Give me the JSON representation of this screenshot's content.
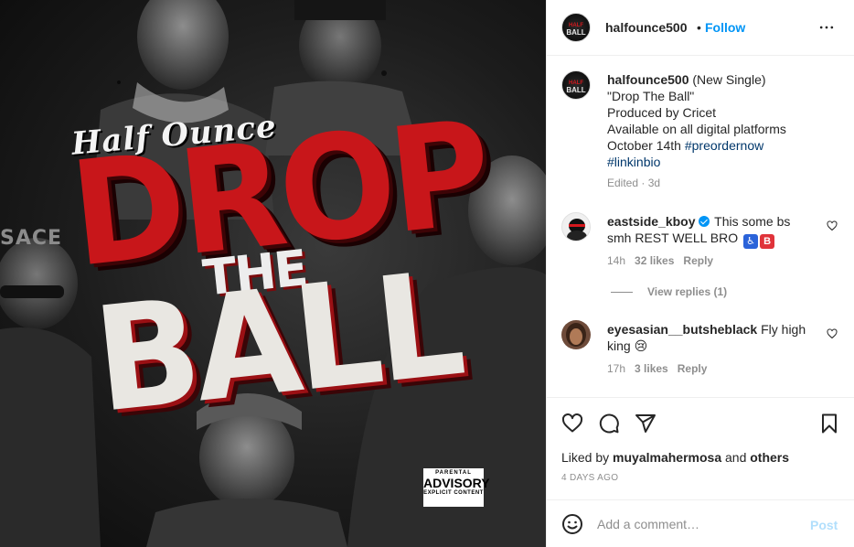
{
  "media": {
    "artist_text": "Half Ounce",
    "title_word1": "DROP",
    "title_word2": "THE",
    "title_word3": "BALL",
    "side_text_left": "SACE",
    "advisory": {
      "line1": "PARENTAL",
      "line2": "ADVISORY",
      "line3": "EXPLICIT CONTENT"
    }
  },
  "header": {
    "username": "halfounce500",
    "separator": "•",
    "follow_label": "Follow",
    "avatar_logo_top": "HALF",
    "avatar_logo_bottom": "BALL",
    "more_icon": "more-horizontal-icon"
  },
  "caption": {
    "username": "halfounce500",
    "line1": "(New Single)",
    "line2": "\"Drop The Ball\"",
    "line3": "Produced by Cricet",
    "line4": "Available on all digital platforms",
    "line5_text": "October 14th ",
    "line5_tag": "#preordernow",
    "line6_tag": "#linkinbio",
    "meta": "Edited · 3d"
  },
  "comments": [
    {
      "username": "eastside_kboy",
      "verified": true,
      "text_line1": "This some bs",
      "text_line2": "smh REST WELL BRO",
      "emoji1": "♿",
      "emoji2": "B",
      "time": "14h",
      "likes": "32 likes",
      "reply": "Reply",
      "view_replies": "View replies (1)"
    },
    {
      "username": "eyesasian__butsheblack",
      "text_line1": "Fly high",
      "text_line2": "king",
      "emoji1": "😢",
      "time": "17h",
      "likes": "3 likes",
      "reply": "Reply"
    }
  ],
  "actions": {
    "liked_by_prefix": "Liked by ",
    "liked_by_user": "muyalmahermosa",
    "liked_by_and": " and ",
    "liked_by_others": "others",
    "date": "4 DAYS AGO"
  },
  "add_comment": {
    "placeholder": "Add a comment…",
    "post_label": "Post"
  },
  "colors": {
    "accent": "#0095f6",
    "link": "#00376b",
    "muted": "#8e8e8e",
    "title_red": "#c8161a",
    "post_disabled": "#b2dffc"
  }
}
